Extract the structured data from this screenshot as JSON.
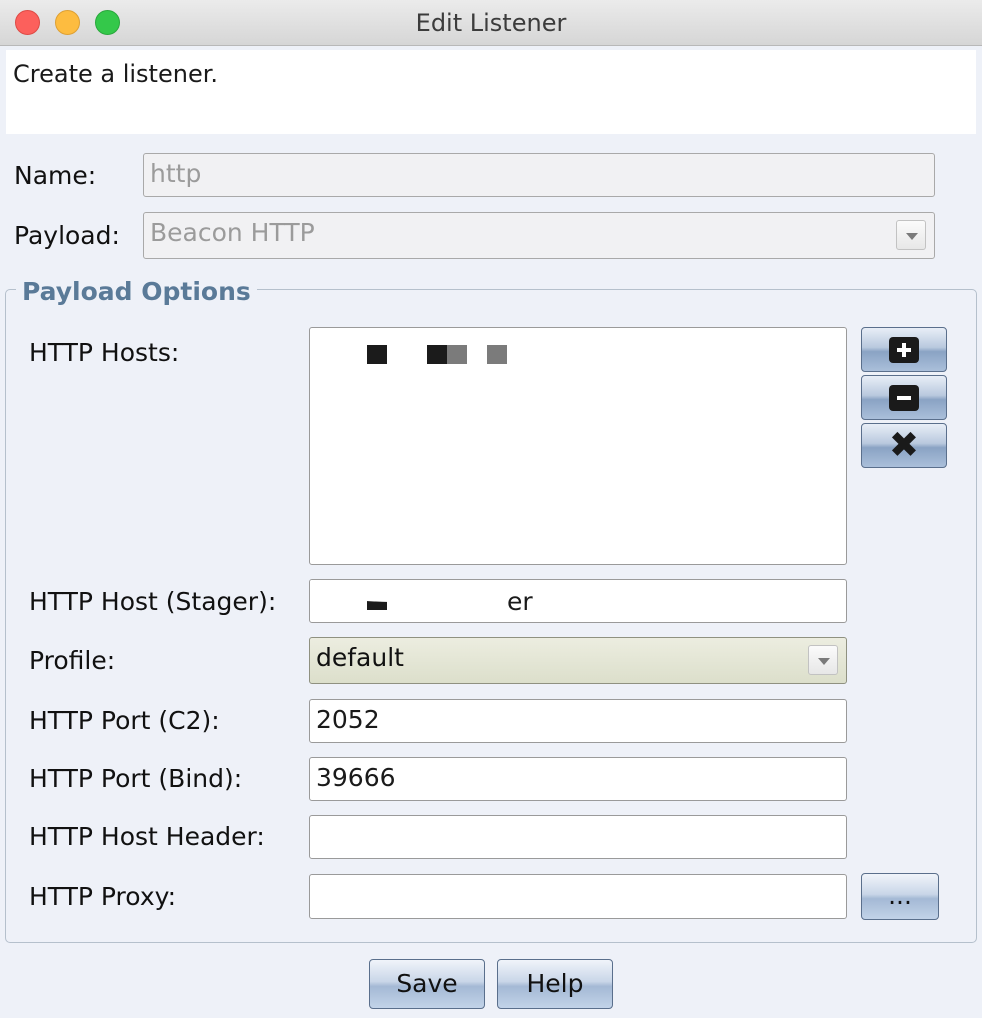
{
  "window": {
    "title": "Edit Listener"
  },
  "description": "Create a listener.",
  "name": {
    "label": "Name:",
    "value": "http"
  },
  "payload": {
    "label": "Payload:",
    "value": "Beacon HTTP"
  },
  "payload_options": {
    "title": "Payload Options",
    "http_hosts": {
      "label": "HTTP Hosts:"
    },
    "http_host_stager": {
      "label": "HTTP Host (Stager):",
      "value": "er"
    },
    "profile": {
      "label": "Profile:",
      "value": "default"
    },
    "http_port_c2": {
      "label": "HTTP Port (C2):",
      "value": "2052"
    },
    "http_port_bind": {
      "label": "HTTP Port (Bind):",
      "value": "39666"
    },
    "http_host_header": {
      "label": "HTTP Host Header:",
      "value": ""
    },
    "http_proxy": {
      "label": "HTTP Proxy:",
      "value": "",
      "browse_label": "..."
    }
  },
  "buttons": {
    "save": "Save",
    "help": "Help"
  },
  "icons": {
    "add": "plus-icon",
    "remove": "minus-icon",
    "clear": "close-x-icon",
    "dropdown": "chevron-down-icon"
  }
}
